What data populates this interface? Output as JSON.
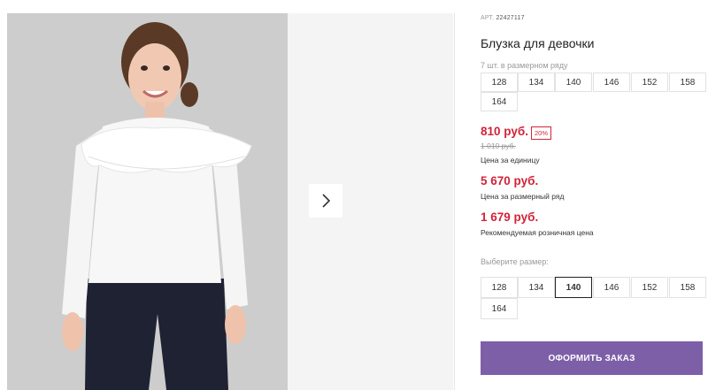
{
  "product": {
    "sku_label": "АРТ.",
    "sku_value": "22427117",
    "title": "Блузка для девочки",
    "pack_note": "7 шт. в размерном ряду",
    "pack_sizes": [
      "128",
      "134",
      "140",
      "146",
      "152",
      "158",
      "164"
    ]
  },
  "pricing": {
    "unit_price": "810 руб.",
    "discount": "20%",
    "old_price": "1 010 руб.",
    "unit_label": "Цена за единицу",
    "pack_price": "5 670 руб.",
    "pack_label": "Цена за размерный ряд",
    "retail_price": "1 679 руб.",
    "retail_label": "Рекомендуемая розничная цена"
  },
  "size_select": {
    "label": "Выберите размер:",
    "sizes": [
      "128",
      "134",
      "140",
      "146",
      "152",
      "158",
      "164"
    ],
    "selected": "140"
  },
  "actions": {
    "order_button": "ОФОРМИТЬ ЗАКАЗ"
  },
  "gallery": {
    "next_icon": "chevron-right-icon"
  },
  "colors": {
    "price_red": "#d1243a",
    "button_purple": "#7d5fa8"
  }
}
